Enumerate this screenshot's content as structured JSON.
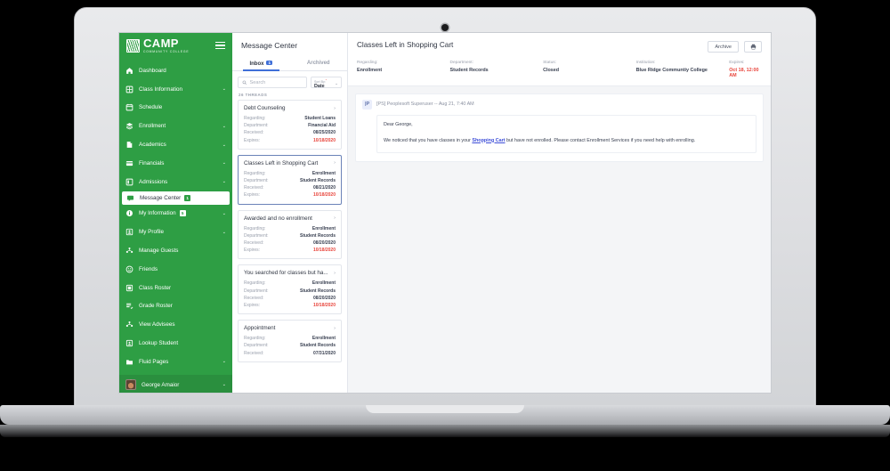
{
  "sidebar": {
    "brand": {
      "name": "CAMP",
      "sub": "COMMUNITY COLLEGE"
    },
    "items": [
      {
        "label": "Dashboard",
        "icon": "home-icon",
        "chevron": false,
        "badge": null
      },
      {
        "label": "Class Information",
        "icon": "grid-icon",
        "chevron": true,
        "badge": null
      },
      {
        "label": "Schedule",
        "icon": "calendar-icon",
        "chevron": false,
        "badge": null
      },
      {
        "label": "Enrollment",
        "icon": "layers-icon",
        "chevron": true,
        "badge": null
      },
      {
        "label": "Academics",
        "icon": "book-icon",
        "chevron": true,
        "badge": null
      },
      {
        "label": "Financials",
        "icon": "card-icon",
        "chevron": true,
        "badge": null
      },
      {
        "label": "Admissions",
        "icon": "note-icon",
        "chevron": true,
        "badge": null
      },
      {
        "label": "Message Center",
        "icon": "chat-icon",
        "chevron": false,
        "badge": "1",
        "active": true
      },
      {
        "label": "My Information",
        "icon": "info-icon",
        "chevron": true,
        "badge": "5"
      },
      {
        "label": "My Profile",
        "icon": "person-icon",
        "chevron": true,
        "badge": null
      },
      {
        "label": "Manage Guests",
        "icon": "people-icon",
        "chevron": false,
        "badge": null
      },
      {
        "label": "Friends",
        "icon": "smiley-icon",
        "chevron": false,
        "badge": null
      },
      {
        "label": "Class Roster",
        "icon": "roster-icon",
        "chevron": false,
        "badge": null
      },
      {
        "label": "Grade Roster",
        "icon": "grade-icon",
        "chevron": false,
        "badge": null
      },
      {
        "label": "View Advisees",
        "icon": "people-icon",
        "chevron": false,
        "badge": null
      },
      {
        "label": "Lookup Student",
        "icon": "student-icon",
        "chevron": false,
        "badge": null
      },
      {
        "label": "Fluid Pages",
        "icon": "folder-icon",
        "chevron": true,
        "badge": null
      }
    ],
    "user": {
      "name": "George Amaior",
      "avatar": "user-avatar",
      "chevron": true
    },
    "menu_icon": "hamburger-icon"
  },
  "list": {
    "title": "Message Center",
    "tabs": [
      {
        "label": "Inbox",
        "count": "1",
        "active": true
      },
      {
        "label": "Archived",
        "count": null,
        "active": false
      }
    ],
    "search": {
      "placeholder": "Search",
      "icon": "search-icon"
    },
    "sort": {
      "label": "Sort By:",
      "required": "*",
      "value": "Date",
      "icon": "chevron-down-icon"
    },
    "threads_count": "26 THREADS",
    "labels": {
      "regarding": "Regarding:",
      "department": "Department:",
      "received": "Received:",
      "expires": "Expires:"
    },
    "cards": [
      {
        "title": "Debt Counseling",
        "regarding": "Student Loans",
        "department": "Financial Aid",
        "received": "08/25/2020",
        "expires": "10/18/2020",
        "selected": false
      },
      {
        "title": "Classes Left in Shopping Cart",
        "regarding": "Enrollment",
        "department": "Student Records",
        "received": "08/21/2020",
        "expires": "10/18/2020",
        "selected": true
      },
      {
        "title": "Awarded and no enrollment",
        "regarding": "Enrollment",
        "department": "Student Records",
        "received": "08/20/2020",
        "expires": "10/18/2020",
        "selected": false
      },
      {
        "title": "You searched for classes but ha...",
        "regarding": "Enrollment",
        "department": "Student Records",
        "received": "08/20/2020",
        "expires": "10/18/2020",
        "selected": false
      },
      {
        "title": "Appointment",
        "regarding": "Enrollment",
        "department": "Student Records",
        "received": "07/31/2020",
        "expires": null,
        "selected": false
      }
    ]
  },
  "detail": {
    "title": "Classes Left in Shopping Cart",
    "archive_label": "Archive",
    "print_icon": "printer-icon",
    "meta": [
      {
        "key": "Regarding:",
        "value": "Enrollment",
        "due": false
      },
      {
        "key": "Department:",
        "value": "Student Records",
        "due": false
      },
      {
        "key": "Status:",
        "value": "Closed",
        "due": false
      },
      {
        "key": "Institution:",
        "value": "Blue Ridge Communtiy College",
        "due": false
      },
      {
        "key": "Expires:",
        "value": "Oct 18, 12:00 AM",
        "due": true
      }
    ],
    "message": {
      "avatar_initials": "|P",
      "from": "[PS] Peoplesoft Superuser -- Aug 21, 7:40 AM",
      "greeting": "Dear George,",
      "body_before": "We noticed that you have classes in your ",
      "body_link": "Shopping Cart",
      "body_after": " but have not enrolled. Please contact Enrollment Services if you need help with enrolling."
    }
  },
  "colors": {
    "brand_green": "#2e9e44",
    "accent_blue": "#3f6fd8",
    "danger_red": "#e8453c",
    "text_dark": "#2f3542",
    "muted": "#9aa0ad"
  }
}
